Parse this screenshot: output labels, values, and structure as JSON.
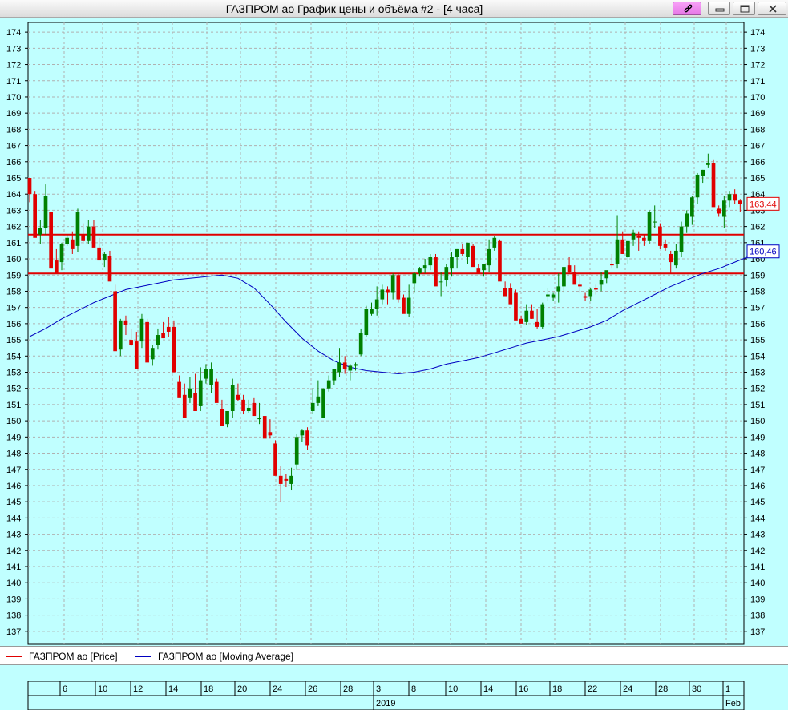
{
  "window": {
    "title": "ГАЗПРОМ ао График цены и объёма #2 - [4 часа]",
    "buttons": [
      "link-icon",
      "minimize-icon",
      "restore-icon",
      "close-icon"
    ]
  },
  "colors": {
    "background": "#c0ffff",
    "up_candle": "#008000",
    "down_candle": "#e00000",
    "moving_average": "#0000c0",
    "level_line": "#e00000",
    "grid": "#b0b0b0"
  },
  "legend": [
    {
      "label": "ГАЗПРОМ ао [Price]",
      "color": "#e00000"
    },
    {
      "label": "ГАЗПРОМ ао [Moving Average]",
      "color": "#0000c0"
    }
  ],
  "date_axis": {
    "days": [
      "6",
      "10",
      "12",
      "14",
      "18",
      "20",
      "24",
      "26",
      "28",
      "3",
      "8",
      "10",
      "14",
      "16",
      "18",
      "22",
      "24",
      "28",
      "30",
      "1"
    ],
    "periods": [
      "2019",
      "Feb"
    ]
  },
  "chart_data": {
    "type": "candlestick",
    "y_ticks": [
      137,
      138,
      139,
      140,
      141,
      142,
      143,
      144,
      145,
      146,
      147,
      148,
      149,
      150,
      151,
      152,
      153,
      154,
      155,
      156,
      157,
      158,
      159,
      160,
      161,
      162,
      163,
      164,
      165,
      166,
      167,
      168,
      169,
      170,
      171,
      172,
      173,
      174
    ],
    "ylim": [
      136.2,
      174.6
    ],
    "grid": true,
    "level_lines": [
      161.5,
      159.1
    ],
    "last_values": {
      "price": "163,44",
      "moving_average": "160,46"
    },
    "candles": [
      [
        165,
        163.5,
        165,
        164
      ],
      [
        164,
        163.9,
        164.2,
        161.3
      ],
      [
        161.5,
        160.9,
        162.4,
        161.9
      ],
      [
        161.9,
        161.5,
        164.6,
        163.9
      ],
      [
        162.9,
        160,
        162.9,
        159.4
      ],
      [
        159.9,
        159.3,
        160.6,
        159.1
      ],
      [
        159.8,
        159.3,
        161,
        160.9
      ],
      [
        160.9,
        160.8,
        161.5,
        161.3
      ],
      [
        161.2,
        160.3,
        161.7,
        160.6
      ],
      [
        160.8,
        160.4,
        163.1,
        162.9
      ],
      [
        161.5,
        160.9,
        162.2,
        161.1
      ],
      [
        161.1,
        160.9,
        162.4,
        162
      ],
      [
        162,
        161.5,
        162.4,
        160.7
      ],
      [
        160.7,
        160.4,
        161.3,
        159.9
      ],
      [
        159.9,
        159.5,
        160.4,
        160.3
      ],
      [
        160.2,
        159.7,
        160.5,
        158.6
      ],
      [
        158,
        157.8,
        158.4,
        154.3
      ],
      [
        154.4,
        154,
        156.3,
        156.2
      ],
      [
        156.2,
        155.3,
        156.5,
        155.9
      ],
      [
        155,
        154.6,
        155.7,
        154.7
      ],
      [
        154.9,
        154.7,
        155.5,
        153.2
      ],
      [
        154.9,
        154.5,
        156.6,
        156.3
      ],
      [
        156.1,
        155.8,
        156.3,
        153.6
      ],
      [
        153.8,
        153.4,
        154.7,
        154.5
      ],
      [
        154.7,
        154.4,
        155.7,
        155.3
      ],
      [
        155.4,
        155.1,
        156.1,
        155.1
      ],
      [
        155.8,
        155.2,
        156.4,
        155.5
      ],
      [
        155.8,
        155.3,
        156.2,
        153
      ],
      [
        152.4,
        152.1,
        152.8,
        151.4
      ],
      [
        151.6,
        151.2,
        152.3,
        150.2
      ],
      [
        151.4,
        151.1,
        152.7,
        152
      ],
      [
        151.7,
        151.5,
        152.9,
        150.6
      ],
      [
        150.9,
        150.6,
        153.3,
        152.5
      ],
      [
        152.6,
        152.3,
        153.5,
        153.2
      ],
      [
        152.2,
        151.7,
        153.6,
        153.2
      ],
      [
        152.4,
        152,
        152.6,
        151.1
      ],
      [
        150.7,
        150.3,
        151.3,
        149.7
      ],
      [
        149.8,
        149.6,
        150.6,
        150.6
      ],
      [
        150.6,
        150.2,
        152.6,
        152.2
      ],
      [
        151.6,
        151.2,
        152.3,
        151.3
      ],
      [
        151.3,
        150.4,
        151.6,
        150.6
      ],
      [
        150.6,
        150.5,
        151.3,
        150.8
      ],
      [
        151.1,
        150.7,
        151.4,
        150.3
      ],
      [
        150.1,
        149.8,
        151.1,
        150.2
      ],
      [
        150.3,
        149.8,
        150.3,
        148.9
      ],
      [
        149.3,
        148.9,
        150.1,
        149.1
      ],
      [
        148.6,
        148.5,
        148.8,
        146.6
      ],
      [
        146.6,
        145,
        147.2,
        146.1
      ],
      [
        146.4,
        145.9,
        146.7,
        146.3
      ],
      [
        146.1,
        145.7,
        147.1,
        146.6
      ],
      [
        147.3,
        147,
        149.2,
        149
      ],
      [
        149.1,
        148.7,
        149.5,
        149.4
      ],
      [
        149.4,
        148.2,
        149.6,
        148.5
      ],
      [
        150.6,
        150.4,
        152,
        151.1
      ],
      [
        151.1,
        150.9,
        152.5,
        151.5
      ],
      [
        150.2,
        150.3,
        152,
        152
      ],
      [
        152,
        151.8,
        152.8,
        152.5
      ],
      [
        152.5,
        152.2,
        153.2,
        153.2
      ],
      [
        153,
        152.7,
        154.5,
        153.6
      ],
      [
        153.6,
        152.9,
        154,
        153.2
      ],
      [
        153.1,
        152.5,
        153.5,
        153.4
      ],
      [
        153.4,
        153.1,
        153.6,
        153.5
      ],
      [
        154.1,
        154,
        155.7,
        155.4
      ],
      [
        155.3,
        155.2,
        157.1,
        156.9
      ],
      [
        156.6,
        156.5,
        157.3,
        156.9
      ],
      [
        156.9,
        156.5,
        158.3,
        157.5
      ],
      [
        157.5,
        157.2,
        158.4,
        158.1
      ],
      [
        158.1,
        157.2,
        158.3,
        157.9
      ],
      [
        157.9,
        157.5,
        159.1,
        159
      ],
      [
        159,
        157.3,
        159.1,
        157.5
      ],
      [
        157.6,
        157.4,
        157.8,
        156.6
      ],
      [
        156.6,
        156.4,
        158.4,
        157.6
      ],
      [
        158.5,
        157.9,
        159.2,
        159.1
      ],
      [
        159.1,
        158.9,
        159.5,
        159.4
      ],
      [
        159.4,
        159.1,
        160,
        159.6
      ],
      [
        159.6,
        159.3,
        160.3,
        160.1
      ],
      [
        160.1,
        159.6,
        160.3,
        158.3
      ],
      [
        158.6,
        157.7,
        159.2,
        158.6
      ],
      [
        158.7,
        158.3,
        159.7,
        159.5
      ],
      [
        159.4,
        158.9,
        160.4,
        160.1
      ],
      [
        160.1,
        159.4,
        160.6,
        160.6
      ],
      [
        160.6,
        160.2,
        160.9,
        160.3
      ],
      [
        160.1,
        159.7,
        160.8,
        161
      ],
      [
        160.8,
        160.3,
        160.9,
        159.5
      ],
      [
        159.4,
        159.1,
        159.7,
        159.1
      ],
      [
        159.3,
        158.9,
        159.5,
        159.7
      ],
      [
        159.6,
        159.2,
        161.2,
        160.6
      ],
      [
        160.7,
        160.5,
        161.4,
        161.3
      ],
      [
        161.1,
        160.9,
        161.2,
        158.6
      ],
      [
        158.2,
        157.9,
        158.6,
        157.7
      ],
      [
        158.2,
        157.9,
        158.5,
        157.2
      ],
      [
        157.9,
        157.7,
        158.1,
        156.2
      ],
      [
        156.3,
        156.1,
        156.5,
        156
      ],
      [
        156.1,
        155.9,
        157.2,
        156.8
      ],
      [
        156.8,
        156.3,
        157.2,
        156.3
      ],
      [
        156.1,
        155.7,
        156.9,
        155.8
      ],
      [
        155.8,
        155.7,
        157.3,
        157.2
      ],
      [
        157.7,
        157.4,
        158.2,
        157.8
      ],
      [
        157.6,
        157.4,
        157.9,
        157.8
      ],
      [
        158,
        157.3,
        159.1,
        158.3
      ],
      [
        158.3,
        157.9,
        159.5,
        159.5
      ],
      [
        159.6,
        159.1,
        160.1,
        159.2
      ],
      [
        159.2,
        159,
        159.6,
        158.4
      ],
      [
        158.4,
        157.9,
        159,
        158.3
      ],
      [
        157.7,
        157.4,
        157.9,
        157.6
      ],
      [
        157.7,
        157.4,
        158.2,
        158.1
      ],
      [
        158.2,
        157.8,
        158.4,
        158.1
      ],
      [
        158.4,
        158,
        159.2,
        158.7
      ],
      [
        158.8,
        158.5,
        159.1,
        159.3
      ],
      [
        159.7,
        159.4,
        160.3,
        159.6
      ],
      [
        159.7,
        159.4,
        162.7,
        161.2
      ],
      [
        161.2,
        160.3,
        161.7,
        160.3
      ],
      [
        160.1,
        159.7,
        160.6,
        161.1
      ],
      [
        161.2,
        160.8,
        161.8,
        161.6
      ],
      [
        161.4,
        160.5,
        161.7,
        161.3
      ],
      [
        161.3,
        160.8,
        161.5,
        161.1
      ],
      [
        161.1,
        160.9,
        163,
        162.9
      ],
      [
        162.3,
        161.9,
        163.3,
        162.3
      ],
      [
        162,
        160.6,
        162.2,
        160.8
      ],
      [
        160.9,
        160.5,
        161.2,
        160.7
      ],
      [
        160.3,
        159.1,
        160.5,
        159.8
      ],
      [
        159.6,
        159.4,
        160.9,
        160.5
      ],
      [
        160.4,
        160.1,
        162.3,
        162
      ],
      [
        162,
        161.6,
        163,
        162.8
      ],
      [
        162.6,
        162.1,
        163.9,
        163.8
      ],
      [
        163.8,
        163.4,
        165.3,
        165.2
      ],
      [
        165.1,
        164.7,
        165.5,
        165.5
      ],
      [
        165.8,
        165.6,
        166.5,
        165.9
      ],
      [
        165.9,
        165.8,
        166.1,
        163.2
      ],
      [
        163.1,
        162.6,
        163.3,
        162.8
      ],
      [
        162.6,
        161.9,
        163.9,
        163.6
      ],
      [
        163.6,
        163.2,
        164.2,
        164
      ],
      [
        164,
        163.4,
        164.3,
        163.6
      ],
      [
        163.6,
        162.9,
        163.7,
        163.4
      ]
    ],
    "moving_average": [
      [
        0,
        155.2
      ],
      [
        3,
        155.7
      ],
      [
        6,
        156.3
      ],
      [
        9,
        156.8
      ],
      [
        12,
        157.3
      ],
      [
        15,
        157.7
      ],
      [
        18,
        158.1
      ],
      [
        21,
        158.3
      ],
      [
        24,
        158.5
      ],
      [
        27,
        158.7
      ],
      [
        30,
        158.8
      ],
      [
        33,
        158.9
      ],
      [
        36,
        159
      ],
      [
        39,
        158.8
      ],
      [
        42,
        158.2
      ],
      [
        45,
        157.2
      ],
      [
        48,
        156.1
      ],
      [
        51,
        155.1
      ],
      [
        54,
        154.3
      ],
      [
        57,
        153.7
      ],
      [
        60,
        153.3
      ],
      [
        63,
        153.1
      ],
      [
        66,
        153
      ],
      [
        69,
        152.9
      ],
      [
        72,
        153
      ],
      [
        75,
        153.2
      ],
      [
        78,
        153.5
      ],
      [
        81,
        153.7
      ],
      [
        84,
        153.9
      ],
      [
        87,
        154.2
      ],
      [
        90,
        154.5
      ],
      [
        93,
        154.8
      ],
      [
        96,
        155
      ],
      [
        99,
        155.2
      ],
      [
        102,
        155.5
      ],
      [
        105,
        155.8
      ],
      [
        108,
        156.2
      ],
      [
        111,
        156.8
      ],
      [
        114,
        157.3
      ],
      [
        117,
        157.8
      ],
      [
        120,
        158.3
      ],
      [
        123,
        158.7
      ],
      [
        126,
        159.1
      ],
      [
        129,
        159.4
      ],
      [
        132,
        159.8
      ],
      [
        135,
        160.2
      ],
      [
        138,
        160.46
      ]
    ]
  }
}
